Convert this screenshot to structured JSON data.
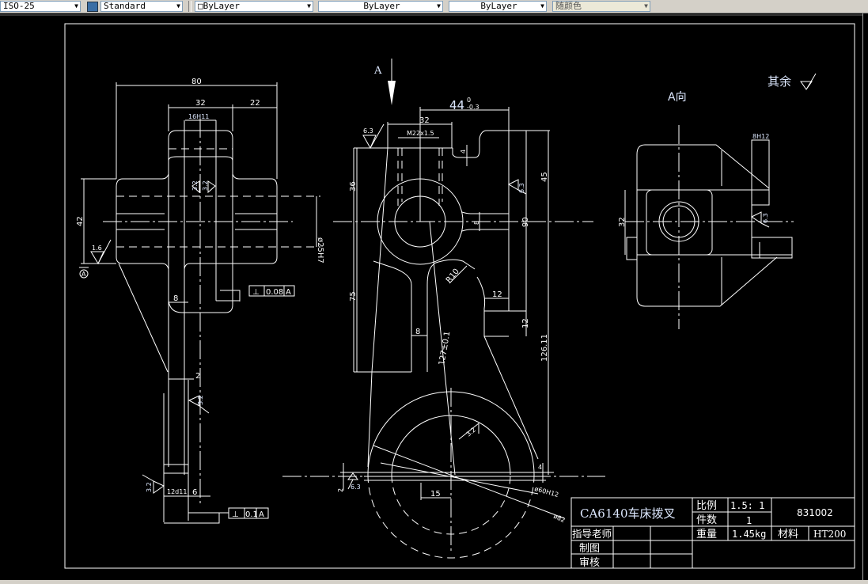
{
  "toolbar": {
    "dimstyle": "ISO-25",
    "textstyle": "Standard",
    "layer": "ByLayer",
    "linetype": "ByLayer",
    "lineweight": "ByLayer",
    "plotstyle": "随颜色"
  },
  "drawing": {
    "view_arrow_label": "A",
    "view_a_title": "A向",
    "remaining_finish": "其余",
    "side_view": {
      "dim_80": "80",
      "dim_32": "32",
      "dim_22": "22",
      "dim_16h11": "16H11",
      "dim_42": "42",
      "dim_phi25h7": "ø25H7",
      "rough_1_6": "1.6",
      "datum": "A",
      "rough_3_2a": "3.2",
      "rough_3_2b": "3.2",
      "rough_3_2c": "3.2",
      "rough_3_2d": "3.2",
      "dim_8": "8",
      "dim_2": "2",
      "dim_12d11": "12d11",
      "dim_6": "6",
      "tol1": {
        "symbol": "⊥",
        "value": "0.08",
        "datum": "A"
      },
      "tol2": {
        "symbol": "⊥",
        "value": "0.1",
        "datum": "A"
      }
    },
    "front_view": {
      "dim_44": "44",
      "dim_44_upper": "0",
      "dim_44_lower": "-0.3",
      "dim_32": "32",
      "dim_m22": "M22x1.5",
      "rough_6_3a": "6.3",
      "rough_6_3b": "6.3",
      "rough_6_3c": "6.3",
      "dim_4": "4",
      "dim_36": "36",
      "dim_75": "75",
      "dim_45": "45",
      "dim_90": "90",
      "dim_8": "8",
      "dim_r10": "R10",
      "dim_12a": "12",
      "dim_12b": "12",
      "dim_8b": "8",
      "dim_127": "127±0.1",
      "dim_126": "126.11",
      "dim_3_2": "3.2",
      "dim_2": "2",
      "dim_15": "15",
      "dim_4b": "4",
      "dim_phi60": "ø60H12",
      "dim_phi82": "ø82"
    },
    "a_view": {
      "dim_8h12": "8H12",
      "dim_32": "32",
      "rough_6_3": "6.3"
    }
  },
  "title_block": {
    "part_name": "CA6140车床拨叉",
    "scale_label": "比例",
    "scale_value": "1.5: 1",
    "qty_label": "件数",
    "qty_value": "1",
    "drawing_no": "831002",
    "weight_label": "重量",
    "weight_value": "1.45kg",
    "material_label": "材料",
    "material_value": "HT200",
    "advisor_label": "指导老师",
    "drawn_label": "制图",
    "checked_label": "审核"
  }
}
